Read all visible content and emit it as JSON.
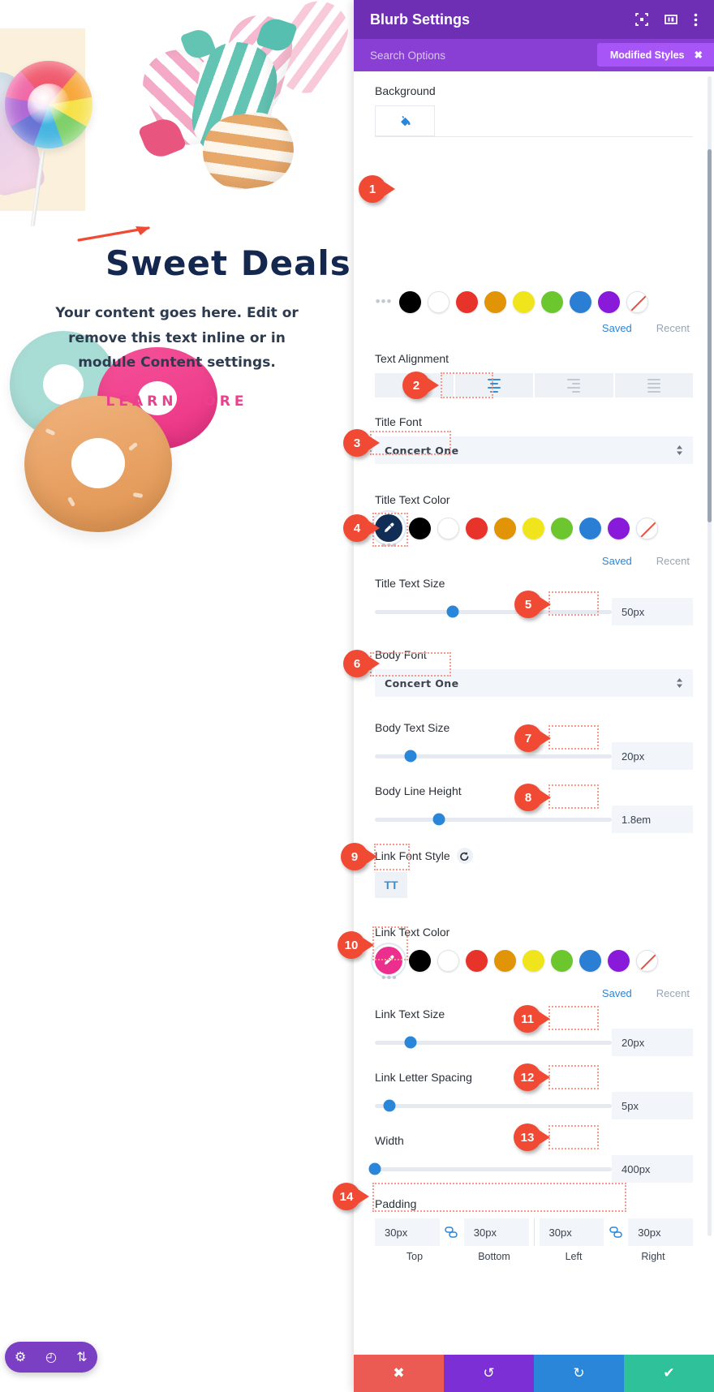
{
  "preview": {
    "title": "Sweet Deals",
    "body": "Your content goes here. Edit or remove this text inline or in module Content settings.",
    "link_label": "LEARN MORE",
    "mini_toolbar": [
      {
        "name": "settings-gear-icon",
        "glyph": "⚙"
      },
      {
        "name": "history-clock-icon",
        "glyph": "◴"
      },
      {
        "name": "sort-arrows-icon",
        "glyph": "⇅"
      }
    ]
  },
  "panel": {
    "title": "Blurb Settings",
    "header_icons": [
      {
        "name": "focus-frame-icon",
        "glyph": "❐"
      },
      {
        "name": "layout-columns-icon",
        "glyph": "▥"
      },
      {
        "name": "kebab-menu-icon",
        "glyph": "⋮"
      }
    ],
    "search": {
      "placeholder": "Search Options",
      "badge_label": "Modified Styles",
      "badge_close": "✖"
    },
    "sections": {
      "background": {
        "label": "Background",
        "icon_name": "paint-bucket-icon"
      },
      "bg_color_palette": {
        "dots": "•••",
        "swatches": [
          "#000000",
          "#ffffff",
          "#e8332a",
          "#e19405",
          "#f0e51c",
          "#6cc72e",
          "#2a7fd4",
          "#8a1ad9",
          "none"
        ],
        "saved_label": "Saved",
        "recent_label": "Recent"
      },
      "text_alignment": {
        "label": "Text Alignment",
        "options": [
          "left",
          "center",
          "justify",
          "right"
        ],
        "selected": "center"
      },
      "title_font": {
        "label": "Title Font",
        "value": "Concert One"
      },
      "title_text_color": {
        "label": "Title Text Color",
        "active_color": "#122d55",
        "active_icon": "eyedropper-icon",
        "swatches": [
          "#000000",
          "#ffffff",
          "#e8332a",
          "#e19405",
          "#f0e51c",
          "#6cc72e",
          "#2a7fd4",
          "#8a1ad9",
          "none"
        ],
        "saved_label": "Saved",
        "recent_label": "Recent"
      },
      "title_text_size": {
        "label": "Title Text Size",
        "value": "50px",
        "thumb_percent": 33
      },
      "body_font": {
        "label": "Body Font",
        "value": "Concert One"
      },
      "body_text_size": {
        "label": "Body Text Size",
        "value": "20px",
        "thumb_percent": 15
      },
      "body_line_height": {
        "label": "Body Line Height",
        "value": "1.8em",
        "thumb_percent": 27
      },
      "link_font_style": {
        "label": "Link Font Style",
        "reset_icon": "reset-arrow-icon",
        "toggle_label": "TT"
      },
      "link_text_color": {
        "label": "Link Text Color",
        "active_color": "#ec2f8e",
        "active_icon": "eyedropper-icon",
        "swatches": [
          "#000000",
          "#ffffff",
          "#e8332a",
          "#e19405",
          "#f0e51c",
          "#6cc72e",
          "#2a7fd4",
          "#8a1ad9",
          "none"
        ],
        "saved_label": "Saved",
        "recent_label": "Recent"
      },
      "link_text_size": {
        "label": "Link Text Size",
        "value": "20px",
        "thumb_percent": 15
      },
      "link_letter_spacing": {
        "label": "Link Letter Spacing",
        "value": "5px",
        "thumb_percent": 6
      },
      "width": {
        "label": "Width",
        "value": "400px",
        "thumb_percent": 0
      },
      "padding": {
        "label": "Padding",
        "top": {
          "label": "Top",
          "value": "30px"
        },
        "bottom": {
          "label": "Bottom",
          "value": "30px"
        },
        "left": {
          "label": "Left",
          "value": "30px"
        },
        "right": {
          "label": "Right",
          "value": "30px"
        },
        "link_icon": "link-sync-icon"
      }
    },
    "footer": [
      {
        "name": "cancel-button",
        "glyph": "✖",
        "color": "#eb5a53"
      },
      {
        "name": "undo-button",
        "glyph": "↺",
        "color": "#7b2fd4"
      },
      {
        "name": "redo-button",
        "glyph": "↻",
        "color": "#2a86d8"
      },
      {
        "name": "save-button",
        "glyph": "✔",
        "color": "#2fc29a"
      }
    ]
  },
  "callouts": [
    {
      "number": "1"
    },
    {
      "number": "2"
    },
    {
      "number": "3"
    },
    {
      "number": "4"
    },
    {
      "number": "5"
    },
    {
      "number": "6"
    },
    {
      "number": "7"
    },
    {
      "number": "8"
    },
    {
      "number": "9"
    },
    {
      "number": "10"
    },
    {
      "number": "11"
    },
    {
      "number": "12"
    },
    {
      "number": "13"
    },
    {
      "number": "14"
    }
  ]
}
